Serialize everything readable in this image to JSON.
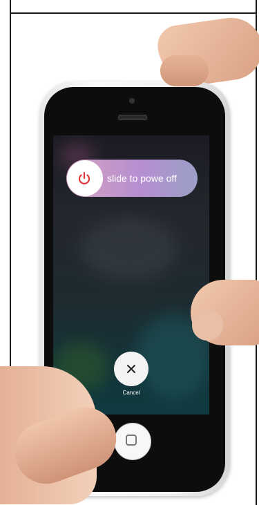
{
  "power_off_slider": {
    "label": "slide to powe  off",
    "icon": "power-icon"
  },
  "cancel": {
    "label": "Cancel",
    "icon": "close-icon"
  },
  "home_button": {
    "icon": "home-button-icon"
  },
  "colors": {
    "power_icon": "#e5363a",
    "slider_start": "#d6a3c0",
    "slider_end": "#9b9fc7",
    "screen_bottom": "#0f3b40"
  }
}
